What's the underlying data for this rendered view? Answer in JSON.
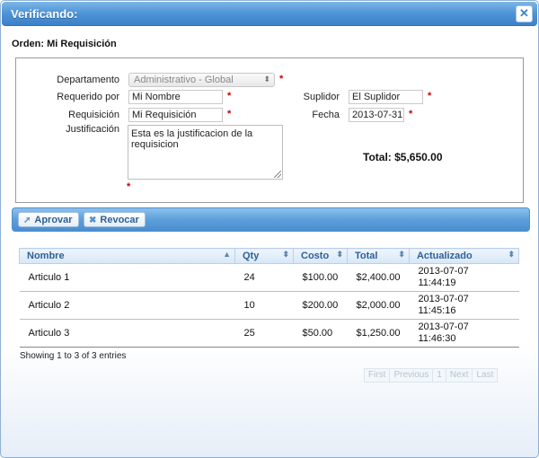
{
  "dialog": {
    "title": "Verificando:",
    "close_icon": "close-icon"
  },
  "order": {
    "title": "Orden: Mi Requisición"
  },
  "form": {
    "departamento_label": "Departamento",
    "departamento_value": "Administrativo - Global",
    "requerido_label": "Requerido por",
    "requerido_value": "Mi Nombre",
    "requisicion_label": "Requisición",
    "requisicion_value": "Mi Requisición",
    "justificacion_label": "Justificación",
    "justificacion_value": "Esta es la justificacion de la requisicion",
    "suplidor_label": "Suplidor",
    "suplidor_value": "El Suplidor",
    "fecha_label": "Fecha",
    "fecha_value": "2013-07-31",
    "required_mark": "*",
    "total": "Total: $5,650.00"
  },
  "toolbar": {
    "approve_label": "Aprovar",
    "revoke_label": "Revocar"
  },
  "table": {
    "headers": [
      "Nombre",
      "Qty",
      "Costo",
      "Total",
      "Actualizado"
    ],
    "rows": [
      [
        "Articulo 1",
        "24",
        "$100.00",
        "$2,400.00",
        "2013-07-07",
        "11:44:19"
      ],
      [
        "Articulo 2",
        "10",
        "$200.00",
        "$2,000.00",
        "2013-07-07",
        "11:45:16"
      ],
      [
        "Articulo 3",
        "25",
        "$50.00",
        "$1,250.00",
        "2013-07-07",
        "11:46:30"
      ]
    ]
  },
  "info": "Showing 1 to 3 of 3 entries",
  "pager": {
    "first": "First",
    "previous": "Previous",
    "page": "1",
    "next": "Next",
    "last": "Last"
  },
  "colors": {
    "accent": "#3d82c9",
    "required": "#cc0000",
    "header_text": "#2f5f98"
  }
}
